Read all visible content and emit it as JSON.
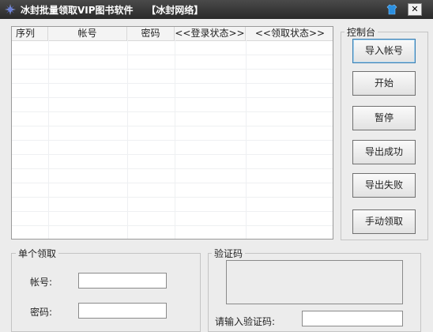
{
  "window": {
    "title": "冰封批量领取VIP图书软件    【冰封网络】",
    "close_glyph": "✕"
  },
  "list": {
    "columns": [
      "序列",
      "帐号",
      "密码",
      "<<登录状态>>",
      "<<领取状态>>"
    ]
  },
  "control_panel": {
    "title": "控制台",
    "buttons": [
      "导入帐号",
      "开始",
      "暂停",
      "导出成功",
      "导出失败",
      "手动领取"
    ]
  },
  "single": {
    "title": "单个领取",
    "account_label": "帐号:",
    "account_value": "",
    "password_label": "密码:",
    "password_value": ""
  },
  "captcha": {
    "title": "验证码",
    "input_label": "请输入验证码:",
    "input_value": ""
  },
  "colors": {
    "titlebar": "#2a2a2a",
    "accent": "#3c7fb1"
  }
}
